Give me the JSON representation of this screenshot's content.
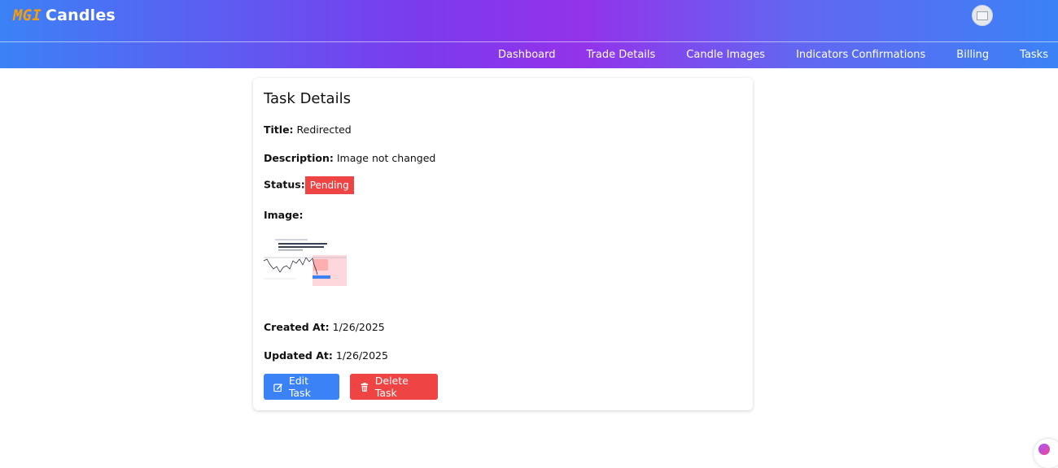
{
  "brand": {
    "part1": "MGI",
    "part2": "Candles"
  },
  "nav": {
    "items": [
      {
        "label": "Dashboard"
      },
      {
        "label": "Trade Details"
      },
      {
        "label": "Candle Images"
      },
      {
        "label": "Indicators Confirmations"
      },
      {
        "label": "Billing"
      },
      {
        "label": "Tasks"
      }
    ]
  },
  "task": {
    "heading": "Task Details",
    "title_label": "Title:",
    "title_value": "Redirected",
    "description_label": "Description:",
    "description_value": "Image not changed",
    "status_label": "Status:",
    "status_value": "Pending",
    "image_label": "Image:",
    "created_label": "Created At:",
    "created_value": "1/26/2025",
    "updated_label": "Updated At:",
    "updated_value": "1/26/2025"
  },
  "actions": {
    "edit_label": "Edit Task",
    "delete_label": "Delete Task"
  },
  "colors": {
    "status_pending": "#ef4444",
    "edit_button": "#3b82f6",
    "delete_button": "#ef4444",
    "brand_accent": "#f59e0b"
  }
}
